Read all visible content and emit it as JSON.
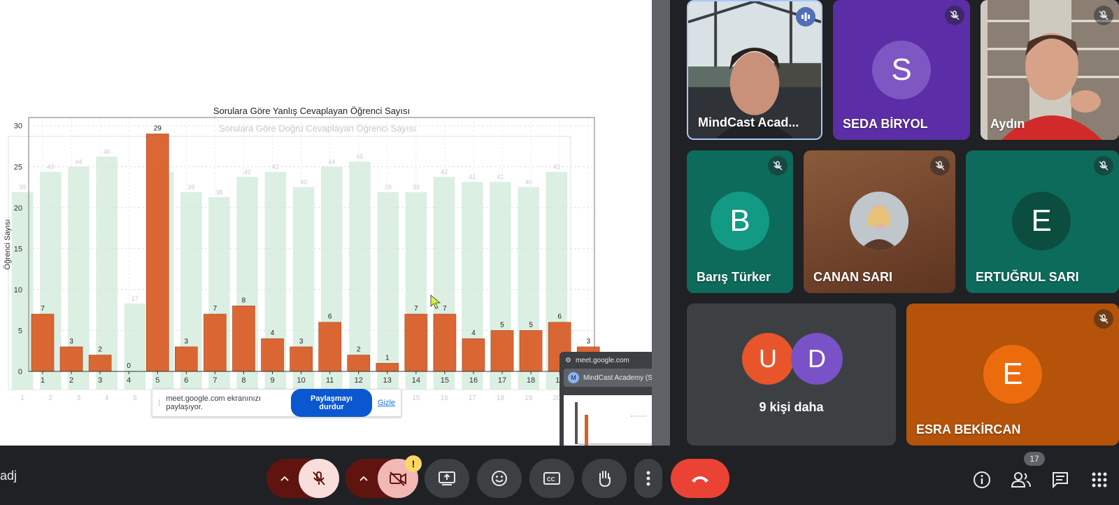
{
  "app": {
    "meeting_code": "adj"
  },
  "presentation": {
    "banner_text": "meet.google.com ekranınızı paylaşıyor.",
    "stop_button": "Paylaşmayı durdur",
    "hide_link": "Gizle",
    "mini_preview": {
      "url": "meet.google.com",
      "presenter": "MindCast Academy (Siz, e",
      "avatar_letter": "M"
    }
  },
  "chart_data": [
    {
      "type": "bar",
      "title": "Sorulara Göre Yanlış Cevaplayan Öğrenci Sayısı",
      "ylabel": "Öğrenci Sayısı",
      "xlabel": "",
      "categories": [
        "1",
        "2",
        "3",
        "4",
        "5",
        "6",
        "7",
        "8",
        "9",
        "10",
        "11",
        "12",
        "13",
        "14",
        "15",
        "16",
        "17",
        "18",
        "19",
        "20"
      ],
      "values": [
        7,
        3,
        2,
        0,
        29,
        3,
        7,
        8,
        4,
        3,
        6,
        2,
        1,
        7,
        7,
        4,
        5,
        5,
        6,
        3
      ],
      "ylim": [
        0,
        31
      ],
      "yticks": [
        0,
        5,
        10,
        15,
        20,
        25,
        30
      ],
      "color": "#d95f2a",
      "grid": true
    },
    {
      "type": "bar",
      "title": "Sorulara Göre Doğru Cevaplayan Öğrenci Sayısı",
      "categories": [
        "1",
        "2",
        "3",
        "4",
        "5",
        "6",
        "7",
        "8",
        "9",
        "10",
        "11",
        "12",
        "13",
        "14",
        "15",
        "16",
        "17",
        "18",
        "19",
        "20"
      ],
      "values": [
        39,
        43,
        44,
        46,
        17,
        43,
        39,
        38,
        42,
        43,
        40,
        44,
        45,
        39,
        39,
        42,
        41,
        41,
        40,
        43
      ],
      "ylim": [
        0,
        50
      ],
      "color": "#cfe9d8",
      "grid": true
    }
  ],
  "participants": [
    {
      "name": "MindCast Acad...",
      "type": "camera",
      "speaking": true
    },
    {
      "name": "SEDA BİRYOL",
      "type": "avatar",
      "letter": "S",
      "color": "#7e57c2",
      "bg": "#5b2da6",
      "muted": true
    },
    {
      "name": "Aydın",
      "type": "camera",
      "muted": true
    },
    {
      "name": "Barış Türker",
      "type": "avatar",
      "letter": "B",
      "color": "#129a84",
      "bg": "#0d6b5c",
      "muted": true
    },
    {
      "name": "CANAN SARI",
      "type": "photo",
      "bg": "#7a4a2e",
      "muted": true
    },
    {
      "name": "ERTUĞRUL SARI",
      "type": "avatar",
      "letter": "E",
      "color": "#0b4e3f",
      "bg": "#0d6b5c",
      "muted": true
    },
    {
      "name": "9 kişi daha",
      "type": "group",
      "letters": [
        "U",
        "D"
      ],
      "colors": [
        "#e8552a",
        "#7a52c7"
      ],
      "bg": "#3c4043"
    },
    {
      "name": "ESRA BEKİRCAN",
      "type": "avatar",
      "letter": "E",
      "color": "#ec6c0d",
      "bg": "#b45309",
      "muted": true
    }
  ],
  "toolbar": {
    "icons": [
      "mic-off-icon",
      "camera-off-icon",
      "present-icon",
      "emoji-icon",
      "captions-icon",
      "raise-hand-icon",
      "more-options-icon",
      "end-call-icon"
    ],
    "camera_warning": "!",
    "people_count": "17",
    "colors": {
      "danger": "#ea4335",
      "mic_off_bg": "#f9dedc",
      "dark_red": "#601410"
    }
  }
}
